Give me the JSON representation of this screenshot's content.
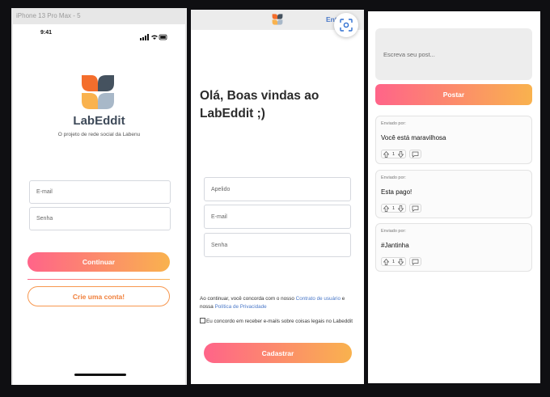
{
  "colors": {
    "gradient_start": "#ff6489",
    "gradient_end": "#f9b24e",
    "link": "#4a78c8",
    "brand_text": "#3e4a59"
  },
  "login": {
    "device_label": "iPhone 13 Pro Max - 5",
    "status_time": "9:41",
    "brand_name": "LabEddit",
    "tagline": "O projeto de rede social da Labenu",
    "email_placeholder": "E-mail",
    "password_placeholder": "Senha",
    "continue_label": "Continuar",
    "create_account_label": "Crie uma conta!"
  },
  "signup": {
    "enter_link": "Entrar",
    "welcome_title": "Olá, Boas vindas ao LabEddit ;)",
    "nickname_placeholder": "Apelido",
    "email_placeholder": "E-mail",
    "password_placeholder": "Senha",
    "terms_prefix": "Ao continuar, você concorda com o nosso ",
    "terms_link": "Contrato de usuário",
    "terms_middle": " e nossa ",
    "privacy_link": "Política de Privacidade",
    "consent_text": "Eu concordo em receber e-mails sobre coisas legais no Labeddit",
    "submit_label": "Cadastrar"
  },
  "feed": {
    "post_placeholder": "Escreva seu post...",
    "post_button": "Postar",
    "posts": [
      {
        "author": "Enviado por:",
        "content": "Você está maravilhosa",
        "votes": "1"
      },
      {
        "author": "Enviado por:",
        "content": "Esta pago!",
        "votes": "1"
      },
      {
        "author": "Enviado por:",
        "content": "#Jantinha",
        "votes": "1"
      }
    ],
    "icons": {
      "upvote": "arrow-up-icon",
      "downvote": "arrow-down-icon",
      "comment": "comment-icon"
    }
  }
}
